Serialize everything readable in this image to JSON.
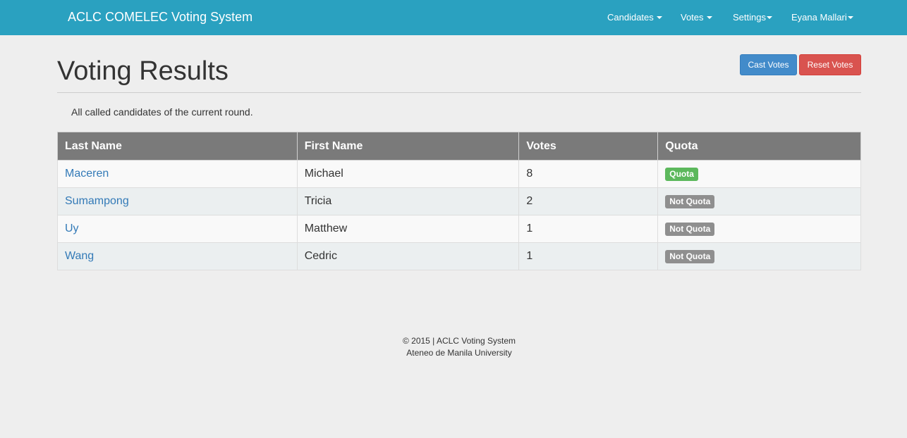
{
  "navbar": {
    "brand": "ACLC COMELEC Voting System",
    "menu": [
      {
        "label": "Candidates"
      },
      {
        "label": "Votes"
      },
      {
        "label": "Settings"
      },
      {
        "label": "Eyana Mallari"
      }
    ],
    "colors": {
      "background": "#2aa1c0"
    }
  },
  "header": {
    "title": "Voting Results",
    "cast_votes_label": "Cast Votes",
    "reset_votes_label": "Reset Votes"
  },
  "main": {
    "subtitle": "All called candidates of the current round."
  },
  "table": {
    "columns": [
      "Last Name",
      "First Name",
      "Votes",
      "Quota"
    ],
    "rows": [
      {
        "last_name": "Maceren",
        "first_name": "Michael",
        "votes": "8",
        "quota": "Quota"
      },
      {
        "last_name": "Sumampong",
        "first_name": "Tricia",
        "votes": "2",
        "quota": "Not Quota"
      },
      {
        "last_name": "Uy",
        "first_name": "Matthew",
        "votes": "1",
        "quota": "Not Quota"
      },
      {
        "last_name": "Wang",
        "first_name": "Cedric",
        "votes": "1",
        "quota": "Not Quota"
      }
    ],
    "colors": {
      "quota": "#5cb85c",
      "not_quota": "#8f8f8f"
    }
  },
  "footer": {
    "line1": "© 2015 | ACLC Voting System",
    "line2": "Ateneo de Manila University"
  }
}
